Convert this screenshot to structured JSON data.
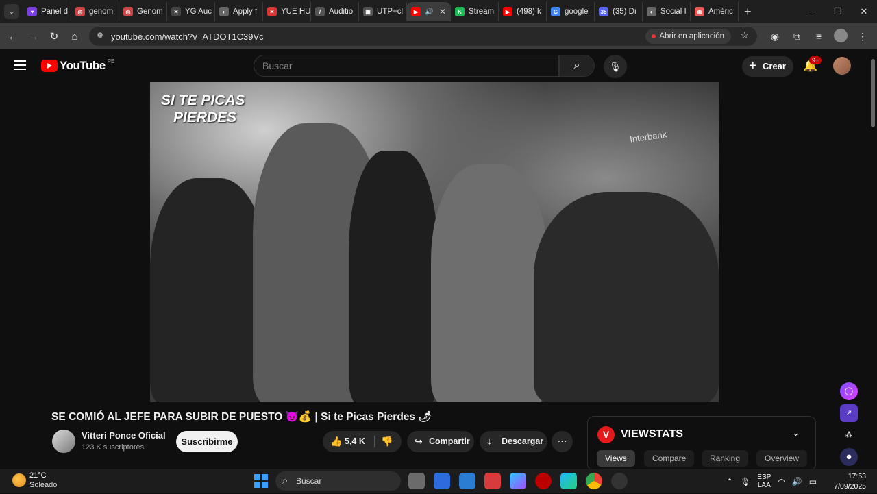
{
  "browser": {
    "tabs": [
      {
        "label": "Panel d",
        "color": "#7b3fe4",
        "glyph": "♥"
      },
      {
        "label": "genom",
        "color": "#c44",
        "glyph": "◎"
      },
      {
        "label": "Genom",
        "color": "#c44",
        "glyph": "◎"
      },
      {
        "label": "YG Auc",
        "color": "#444",
        "glyph": "✕"
      },
      {
        "label": "Apply f",
        "color": "#666",
        "glyph": "◐"
      },
      {
        "label": "YUE HU",
        "color": "#d33",
        "glyph": "✕"
      },
      {
        "label": "Auditio",
        "color": "#555",
        "glyph": "/"
      },
      {
        "label": "UTP+cl",
        "color": "#555",
        "glyph": "▦"
      },
      {
        "label": "",
        "color": "#f00",
        "glyph": "▶",
        "active": true
      },
      {
        "label": "Stream",
        "color": "#1db954",
        "glyph": "K"
      },
      {
        "label": "(498) k",
        "color": "#f00",
        "glyph": "▶"
      },
      {
        "label": "google",
        "color": "#4285f4",
        "glyph": "G"
      },
      {
        "label": "(35) Di",
        "color": "#5865f2",
        "glyph": "35"
      },
      {
        "label": "Social I",
        "color": "#666",
        "glyph": "◐"
      },
      {
        "label": "Améric",
        "color": "#e55",
        "glyph": "◍"
      }
    ],
    "url": "youtube.com/watch?v=ATDOT1C39Vc",
    "open_in_app": "Abrir en aplicación"
  },
  "youtube": {
    "logo_text": "YouTube",
    "country": "PE",
    "search_placeholder": "Buscar",
    "create_label": "Crear",
    "notifications": "9+"
  },
  "video": {
    "overlay_line1": "SI TE PICAS",
    "overlay_line2": "PIERDES",
    "sign_text": "Interbank",
    "title": "SE COMIÓ AL JEFE PARA SUBIR DE PUESTO 😈💰 | Si te Picas Pierdes 🌶",
    "channel": "Vitteri Ponce Oficial",
    "subscribers": "123 K suscriptores",
    "subscribe_label": "Suscribirme",
    "likes": "5,4 K",
    "share_label": "Compartir",
    "download_label": "Descargar"
  },
  "viewstats": {
    "logo": "V",
    "title": "VIEWSTATS",
    "tabs": [
      "Views",
      "Compare",
      "Ranking",
      "Overview"
    ]
  },
  "taskbar": {
    "temperature": "21°C",
    "weather": "Soleado",
    "search_placeholder": "Buscar",
    "lang_line1": "ESP",
    "lang_line2": "LAA",
    "time": "17:53",
    "date": "7/09/2025"
  }
}
